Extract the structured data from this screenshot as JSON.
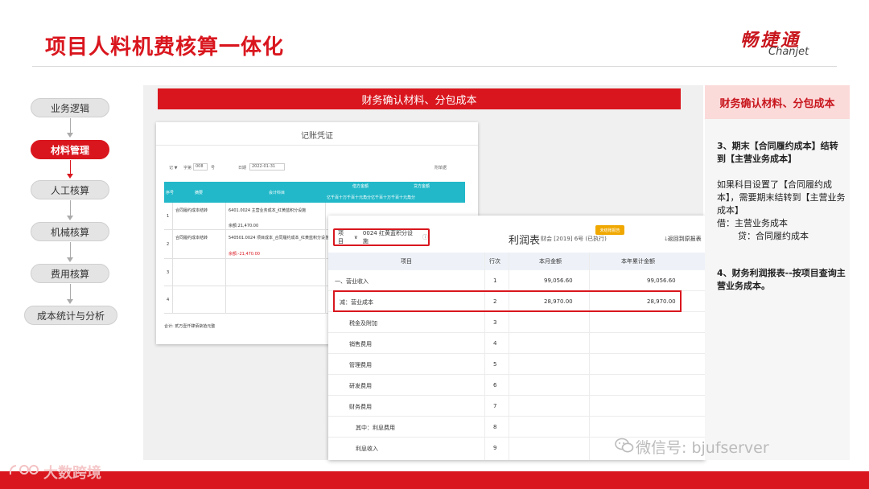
{
  "header": {
    "title": "项目人料机费核算一体化",
    "logo_cn": "畅捷通",
    "logo_en": "Chanjet"
  },
  "flow": {
    "steps": [
      "业务逻辑",
      "材料管理",
      "人工核算",
      "机械核算",
      "费用核算",
      "成本统计与分析"
    ],
    "active_index": 1
  },
  "banner": "财务确认材料、分包成本",
  "voucher": {
    "title": "记账凭证",
    "word_label": "记 ▼",
    "word_no_label": "字第",
    "word_no": "008",
    "no_suffix": "号",
    "date_label": "日期",
    "date": "2022-01-31",
    "attach_label": "附单据",
    "header": {
      "row_no": "序号",
      "summary": "摘要",
      "account": "会计科目",
      "debit": "借方金额",
      "credit": "贷方金额",
      "digits": "亿千百十万千百十元角分亿千百十万千百十元角分"
    },
    "rows": [
      {
        "no": "1",
        "summary": "合同履约成本结转",
        "account": "6401.0024 主营业务成本_红黄蓝积分设施",
        "sub": "余额:21,470.00"
      },
      {
        "no": "2",
        "summary": "合同履约成本结转",
        "account": "540501.0024 项目成本_合同履约成本_红黄蓝积分设施",
        "sub": "余额:-21,470.00"
      },
      {
        "no": "3",
        "summary": "",
        "account": "",
        "sub": ""
      },
      {
        "no": "4",
        "summary": "",
        "account": "",
        "sub": ""
      }
    ],
    "total_label": "合计: 贰万壹仟肆佰柒拾元整"
  },
  "report": {
    "project_label": "项目",
    "project_value": "0024 红黄蓝积分设施",
    "title": "利润表",
    "meta": "财会 [2019] 6号 (已执行)",
    "badge": "未结账报告",
    "back_label": "返回到原报表",
    "columns": [
      "项目",
      "行次",
      "本月金额",
      "本年累计金额"
    ],
    "rows": [
      {
        "item": "一、营业收入",
        "line": "1",
        "month": "99,056.60",
        "year": "99,056.60"
      },
      {
        "item": "减：营业成本",
        "line": "2",
        "month": "28,970.00",
        "year": "28,970.00"
      },
      {
        "item": "税金及附加",
        "line": "3",
        "month": "",
        "year": ""
      },
      {
        "item": "销售费用",
        "line": "4",
        "month": "",
        "year": ""
      },
      {
        "item": "管理费用",
        "line": "5",
        "month": "",
        "year": ""
      },
      {
        "item": "研发费用",
        "line": "6",
        "month": "",
        "year": ""
      },
      {
        "item": "财务费用",
        "line": "7",
        "month": "",
        "year": ""
      },
      {
        "item": "其中：利息费用",
        "line": "8",
        "month": "",
        "year": ""
      },
      {
        "item": "利息收入",
        "line": "9",
        "month": "",
        "year": ""
      }
    ]
  },
  "right_panel": {
    "title": "财务确认材料、分包成本",
    "p1": "3、期末【合同履约成本】结转到【主营业务成本】",
    "p2": "如果科目设置了【合同履约成本】，需要期末结转到【主营业务成本】",
    "p3": "借：主营业务成本",
    "p4": "贷：合同履约成本",
    "p5": "4、财务利润报表--按项目查询主营业务成本。"
  },
  "watermark": "微信号: bjufserver",
  "brand": "大数跨境",
  "colors": {
    "accent": "#d9161e",
    "teal": "#22b8c9"
  }
}
